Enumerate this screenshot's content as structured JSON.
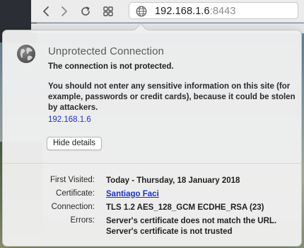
{
  "browser": {
    "address_bar": {
      "host": "192.168.1.6",
      "port": ":8443"
    }
  },
  "popover": {
    "title": "Unprotected Connection",
    "headline": "The connection is not protected.",
    "warning": "You should not enter any sensitive information on this site (for example, passwords or credit cards), because it could be stolen by attackers.",
    "host_link": "192.168.1.6",
    "hide_details_label": "Hide details",
    "details": {
      "first_visited": {
        "label": "First Visited:",
        "value": "Today - Thursday, 18 January 2018"
      },
      "certificate": {
        "label": "Certificate:",
        "value": "Santiago Faci"
      },
      "connection": {
        "label": "Connection:",
        "value": "TLS 1.2 AES_128_GCM ECDHE_RSA (23)"
      },
      "errors": {
        "label": "Errors:",
        "line1": "Server's certificate does not match the URL.",
        "line2": "Server's certificate is not trusted"
      }
    }
  },
  "colors": {
    "link": "#1a33c9",
    "title_gray": "#5a5a5a",
    "popover_bg": "#eeeeee"
  }
}
